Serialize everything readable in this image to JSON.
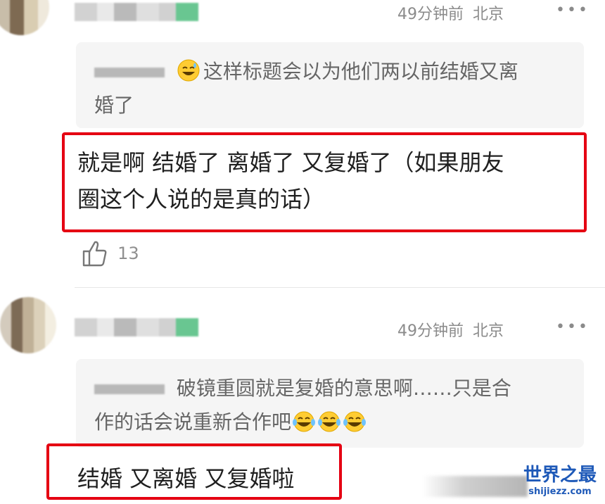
{
  "comments": [
    {
      "meta_time": "49分钟前",
      "meta_location": "北京",
      "more": "•••",
      "quote_text_line1": "这样标题会以为他们两以前结婚又离",
      "quote_text_line2": "婚了",
      "reply_line1": "就是啊 结婚了 离婚了 又复婚了（如果朋友",
      "reply_line2": "圈这个人说的是真的话）",
      "likes": "13"
    },
    {
      "meta_time": "49分钟前",
      "meta_location": "北京",
      "more": "•••",
      "quote_text_line1": "破镜重圆就是复婚的意思啊……只是合",
      "quote_text_line2": "作的话会说重新合作吧",
      "reply_line1": "结婚 又离婚 又复婚啦"
    }
  ],
  "watermark": {
    "title": "世界之最",
    "domain": "shijiezz.com"
  },
  "colors": {
    "highlight_border": "#e50012",
    "meta_text": "#8b8b8b",
    "watermark": "#1e59b8"
  },
  "icons": {
    "like": "thumbs-up-icon",
    "more": "more-dots-icon",
    "emoji1": "sweat-smile-emoji-icon",
    "emoji2": "laughing-tears-emoji-icon"
  }
}
